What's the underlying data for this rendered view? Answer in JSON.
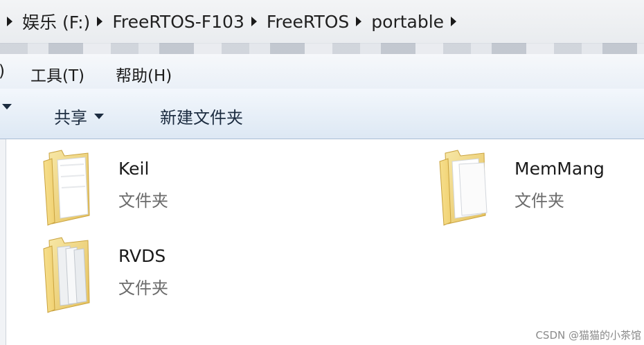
{
  "address": {
    "crumbs": [
      {
        "label": "娱乐 (F:)"
      },
      {
        "label": "FreeRTOS-F103"
      },
      {
        "label": "FreeRTOS"
      },
      {
        "label": "portable"
      }
    ]
  },
  "menu": {
    "partial": ")",
    "tools": "工具(T)",
    "help": "帮助(H)"
  },
  "toolbar": {
    "share": "共享",
    "new_folder": "新建文件夹"
  },
  "files": [
    {
      "name": "Keil",
      "type": "文件夹"
    },
    {
      "name": "MemMang",
      "type": "文件夹"
    },
    {
      "name": "RVDS",
      "type": "文件夹"
    }
  ],
  "watermark": "CSDN @猫猫的小茶馆"
}
